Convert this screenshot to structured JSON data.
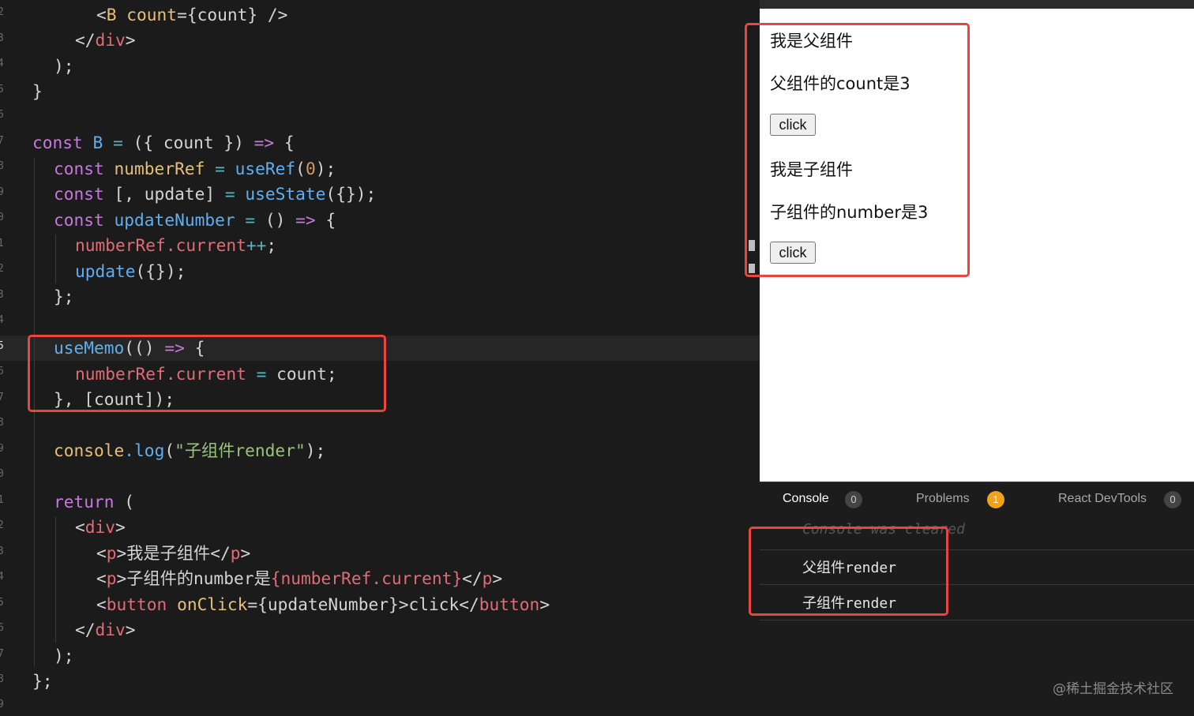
{
  "gutter_numbers": [
    "2",
    "3",
    "4",
    "5",
    "6",
    "7",
    "8",
    "9",
    "0",
    "1",
    "2",
    "3",
    "4",
    "5",
    "6",
    "7",
    "8",
    "9",
    "0",
    "1",
    "2",
    "3",
    "4",
    "5",
    "6",
    "7",
    "8",
    "9"
  ],
  "code": {
    "l1": {
      "a": "<",
      "b": "B",
      "c": " count",
      "d": "={count} />"
    },
    "l2": {
      "a": "</",
      "b": "div",
      "c": ">"
    },
    "l3": {
      "a": ");"
    },
    "l4": {
      "a": "}"
    },
    "l6": {
      "a": "const",
      "b": " B ",
      "c": "=",
      "d": " ({ count }) ",
      "e": "=>",
      "f": " {"
    },
    "l7": {
      "a": "const",
      "b": " numberRef ",
      "c": "=",
      "d": " useRef",
      "e": "(",
      "f": "0",
      "g": ");"
    },
    "l8": {
      "a": "const",
      "b": " [, update] ",
      "c": "=",
      "d": " useState",
      "e": "({});"
    },
    "l9": {
      "a": "const",
      "b": " updateNumber ",
      "c": "=",
      "d": " () ",
      "e": "=>",
      "f": " {"
    },
    "l10": {
      "a": "numberRef",
      "b": ".current",
      "c": "++",
      "d": ";"
    },
    "l11": {
      "a": "update",
      "b": "({});"
    },
    "l12": {
      "a": "};"
    },
    "l14": {
      "a": "useMemo",
      "b": "(() ",
      "c": "=>",
      "d": " {"
    },
    "l15": {
      "a": "numberRef",
      "b": ".current",
      "c": " = ",
      "d": "count;"
    },
    "l16": {
      "a": "}, [count]);"
    },
    "l18": {
      "a": "console",
      "b": ".log",
      "c": "(",
      "d": "\"子组件render\"",
      "e": ");"
    },
    "l20": {
      "a": "return",
      "b": " ("
    },
    "l21": {
      "a": "<",
      "b": "div",
      "c": ">"
    },
    "l22": {
      "a": "<",
      "b": "p",
      "c": ">我是子组件</",
      "d": "p",
      "e": ">"
    },
    "l23": {
      "a": "<",
      "b": "p",
      "c": ">子组件的number是",
      "d": "{numberRef.current}",
      "e": "</",
      "f": "p",
      "g": ">"
    },
    "l24": {
      "a": "<",
      "b": "button",
      "c": " onClick",
      "d": "={updateNumber}>click</",
      "e": "button",
      "f": ">"
    },
    "l25": {
      "a": "</",
      "b": "div",
      "c": ">"
    },
    "l26": {
      "a": ");"
    },
    "l27": {
      "a": "};"
    }
  },
  "preview": {
    "parent_title": "我是父组件",
    "parent_count": "父组件的count是3",
    "parent_button": "click",
    "child_title": "我是子组件",
    "child_number": "子组件的number是3",
    "child_button": "click"
  },
  "panel": {
    "tabs": [
      {
        "label": "Console",
        "count": "0"
      },
      {
        "label": "Problems",
        "count": "1"
      },
      {
        "label": "React DevTools",
        "count": "0"
      }
    ],
    "cleared_message": "Console was cleared",
    "logs": [
      "父组件render",
      "子组件render"
    ]
  },
  "watermark": "@稀土掘金技术社区",
  "colors": {
    "highlight_box": "#e8463e",
    "badge_warning": "#f0a21a"
  }
}
